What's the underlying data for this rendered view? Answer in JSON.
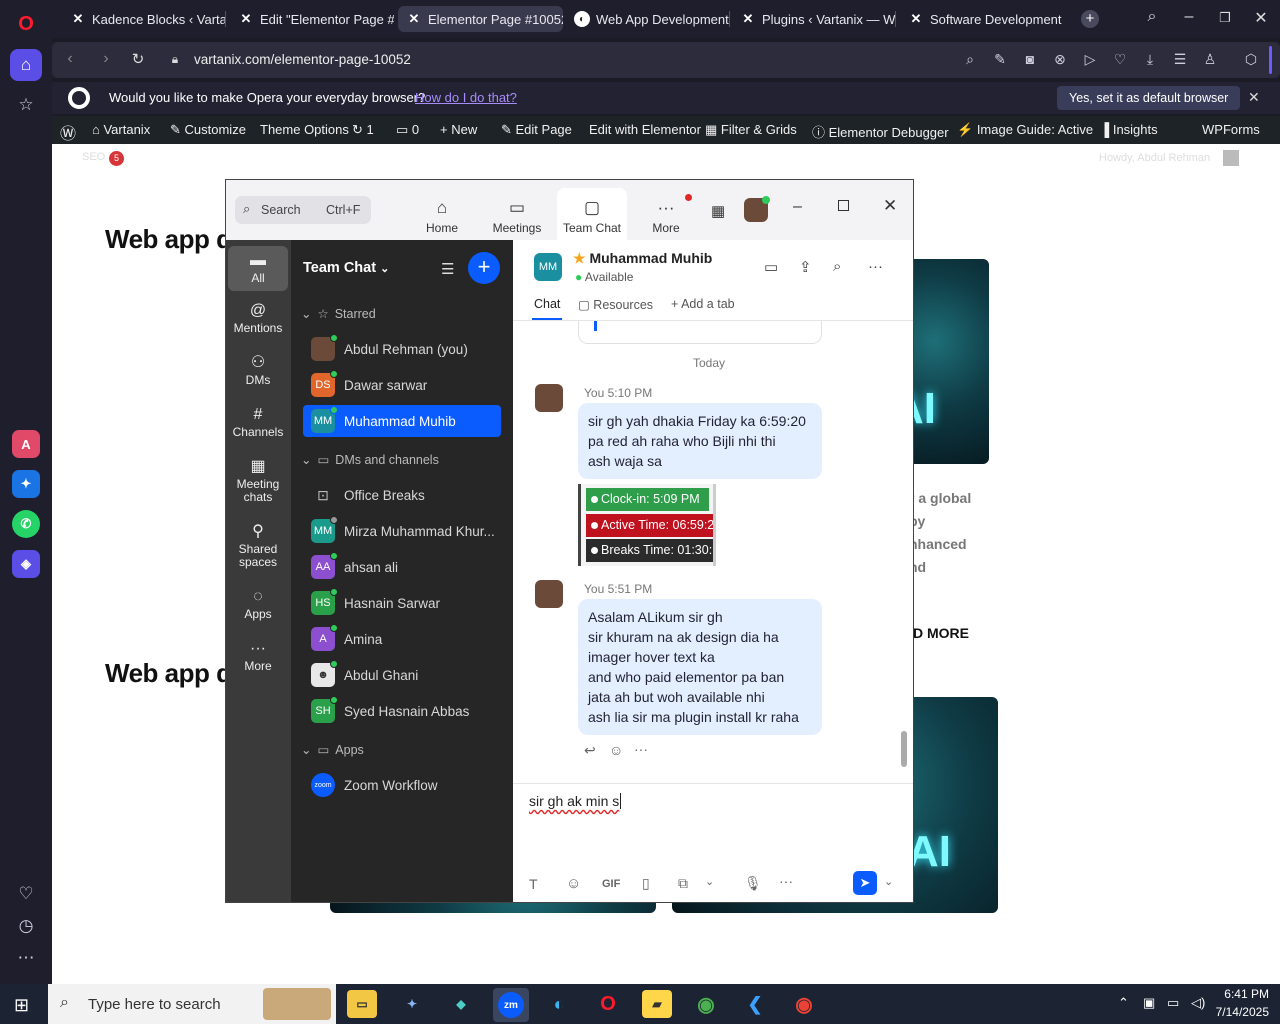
{
  "browser": {
    "tabs": [
      {
        "title": "Kadence Blocks ‹ Vartanix",
        "icon": "wordpress-x-icon"
      },
      {
        "title": "Edit \"Elementor Page #10",
        "icon": "wordpress-x-icon"
      },
      {
        "title": "Elementor Page #10052 -",
        "icon": "wordpress-x-icon",
        "active": true
      },
      {
        "title": "Web App Development C",
        "icon": "site-icon"
      },
      {
        "title": "Plugins ‹ Vartanix — Word",
        "icon": "wordpress-x-icon"
      },
      {
        "title": "Software Development &",
        "icon": "wordpress-x-icon"
      }
    ],
    "url": "vartanix.com/elementor-page-10052",
    "prompt": {
      "message": "Would you like to make Opera your everyday browser?",
      "link": "How do I do that?",
      "button": "Yes, set it as default browser"
    }
  },
  "wp_bar": {
    "items": [
      "Vartanix",
      "Customize",
      "Theme Options",
      "1",
      "0",
      "New",
      "Edit Page",
      "Edit with Elementor",
      "Filter & Grids",
      "Elementor Debugger",
      "Image Guide: Active",
      "Insights",
      "WPForms"
    ],
    "seo_badge": "5",
    "howdy": "Howdy, Abdul Rehman"
  },
  "page": {
    "heading_1": "Web app d",
    "heading_2": "Web app d",
    "side_text": [
      "r a global",
      "by",
      "nhanced",
      "nd"
    ],
    "read_more": "D MORE",
    "image_text": "AI"
  },
  "zoom": {
    "search_placeholder": "Search",
    "search_shortcut": "Ctrl+F",
    "top_tabs": [
      "Home",
      "Meetings",
      "Team Chat",
      "More"
    ],
    "rail": [
      "All",
      "Mentions",
      "DMs",
      "Channels",
      "Meeting chats",
      "Shared spaces",
      "Apps",
      "More"
    ],
    "list_title": "Team Chat",
    "sections": {
      "starred": "Starred",
      "dms": "DMs and channels",
      "apps": "Apps"
    },
    "starred": [
      {
        "name": "Abdul Rehman (you)",
        "initials": "",
        "color": "#6b4a3a"
      },
      {
        "name": "Dawar sarwar",
        "initials": "DS",
        "color": "#e0662b"
      },
      {
        "name": "Muhammad Muhib",
        "initials": "MM",
        "color": "#1a8fa0",
        "selected": true
      }
    ],
    "dms": [
      {
        "name": "Office Breaks",
        "initials": "",
        "color": "transparent"
      },
      {
        "name": "Mirza Muhammad Khur...",
        "initials": "MM",
        "color": "#1a9a8a"
      },
      {
        "name": "ahsan ali",
        "initials": "AA",
        "color": "#8c4fd0"
      },
      {
        "name": "Hasnain Sarwar",
        "initials": "HS",
        "color": "#2aa04a"
      },
      {
        "name": "Amina",
        "initials": "A",
        "color": "#8c4fd0"
      },
      {
        "name": "Abdul Ghani",
        "initials": "",
        "color": "#eeeeee"
      },
      {
        "name": "Syed Hasnain Abbas",
        "initials": "SH",
        "color": "#2aa04a"
      }
    ],
    "apps": [
      {
        "name": "Zoom Workflow",
        "initials": "zoom",
        "color": "#0b5cff"
      }
    ],
    "chat": {
      "contact": "Muhammad Muhib",
      "initials": "MM",
      "status": "Available",
      "tabs": [
        "Chat",
        "Resources",
        "Add a tab"
      ],
      "date_label": "Today",
      "messages": [
        {
          "meta": "You 5:10 PM",
          "lines": [
            "sir gh yah dhakia Friday ka 6:59:20",
            "pa red ah raha who Bijli nhi thi",
            "ash waja sa"
          ]
        },
        {
          "meta": "You 5:51 PM",
          "lines": [
            "Asalam ALikum sir gh",
            "sir khuram na ak design dia ha",
            "imager hover text ka",
            "and who paid elementor pa ban",
            "jata ah but woh available nhi",
            "ash lia sir ma plugin install kr raha"
          ]
        }
      ],
      "attachment": {
        "clock_in": "Clock-in: 5:09 PM",
        "active_time": "Active Time: 06:59:2",
        "breaks": "Breaks Time: 01:30:"
      },
      "composer_text": "sir gh ak min s"
    }
  },
  "taskbar": {
    "search": "Type here to search",
    "time": "6:41 PM",
    "date": "7/14/2025"
  },
  "colors": {
    "zoom_blue": "#0b5cff",
    "bubble": "#e3effe",
    "clock_in_green": "#2e9e4a",
    "active_red": "#c0111f"
  }
}
